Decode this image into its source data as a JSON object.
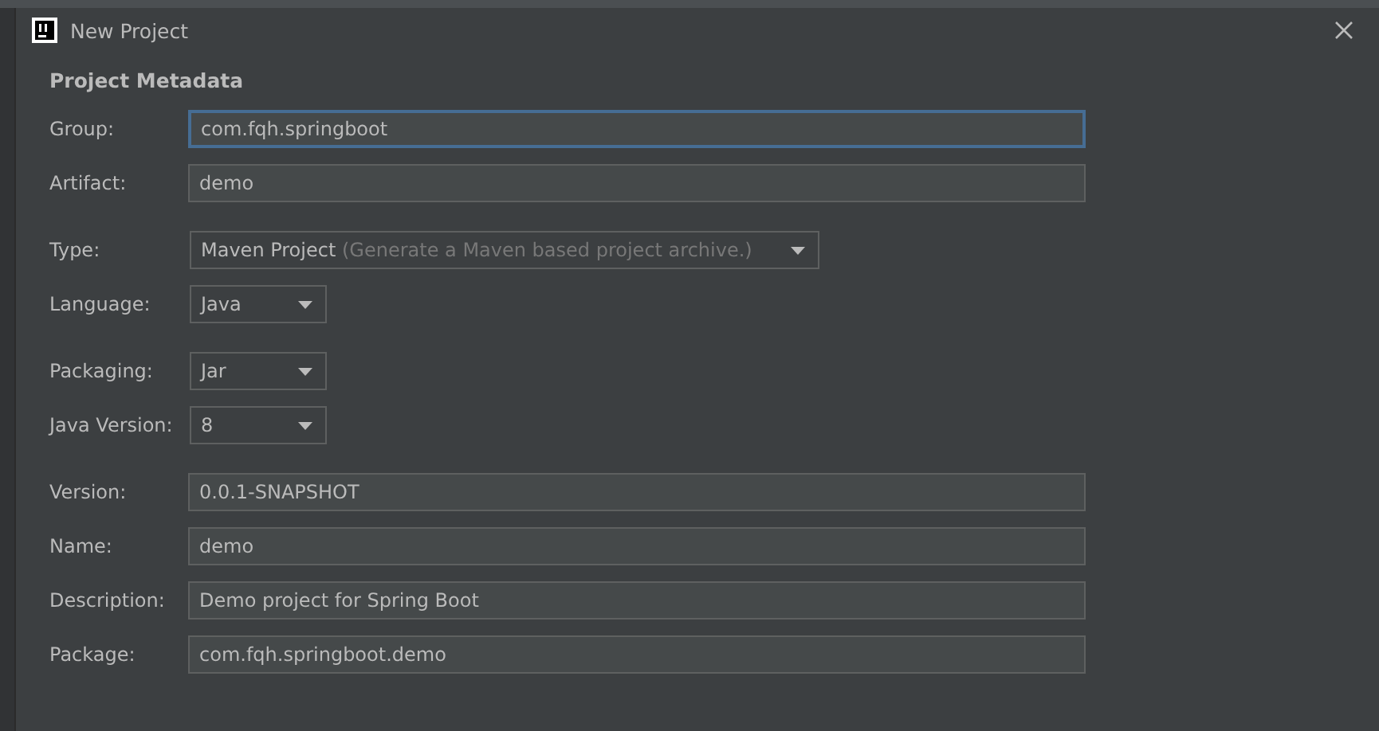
{
  "window": {
    "title": "New Project"
  },
  "section_title": "Project Metadata",
  "sections": [
    [
      {
        "label": "Group:",
        "kind": "text",
        "value": "com.fqh.springboot",
        "focused": true
      },
      {
        "label": "Artifact:",
        "kind": "text",
        "value": "demo",
        "focused": false
      }
    ],
    [
      {
        "label": "Type:",
        "kind": "dropdown",
        "value": "Maven Project",
        "hint": "(Generate a Maven based project archive.)",
        "focused": false
      },
      {
        "label": "Language:",
        "kind": "dropdown",
        "value": "Java",
        "focused": false
      }
    ],
    [
      {
        "label": "Packaging:",
        "kind": "dropdown",
        "value": "Jar",
        "focused": false
      },
      {
        "label": "Java Version:",
        "kind": "dropdown",
        "value": "8",
        "focused": false
      }
    ],
    [
      {
        "label": "Version:",
        "kind": "text",
        "value": "0.0.1-SNAPSHOT",
        "focused": false
      },
      {
        "label": "Name:",
        "kind": "text",
        "value": "demo",
        "focused": false
      },
      {
        "label": "Description:",
        "kind": "text",
        "value": "Demo project for Spring Boot",
        "focused": false
      },
      {
        "label": "Package:",
        "kind": "text",
        "value": "com.fqh.springboot.demo",
        "focused": false
      }
    ]
  ]
}
